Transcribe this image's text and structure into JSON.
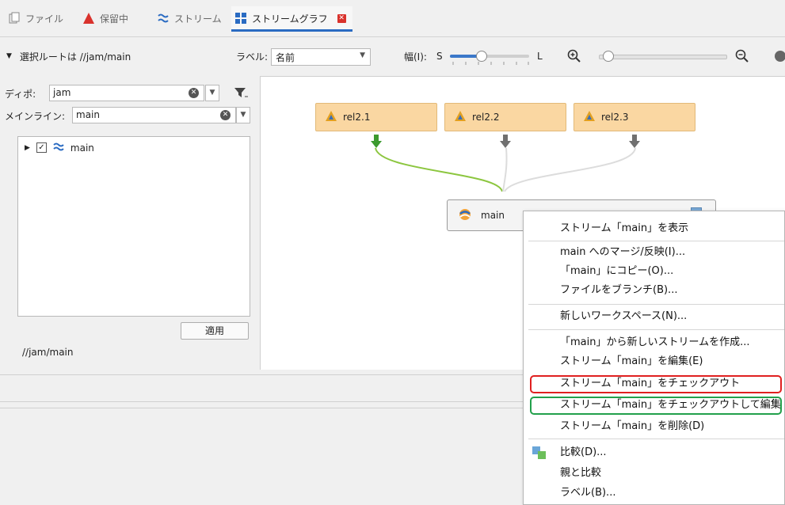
{
  "tabs": [
    {
      "label": "ファイル",
      "icon": "file-icon"
    },
    {
      "label": "保留中",
      "icon": "pending-triangle-icon"
    },
    {
      "label": "ストリーム",
      "icon": "stream-icon"
    },
    {
      "label": "ストリームグラフ",
      "icon": "stream-graph-icon",
      "close": "✕"
    }
  ],
  "toolbar": {
    "root_text": "選択ルートは //jam/main",
    "label_caption": "ラベル:",
    "label_value": "名前",
    "width_caption": "幅(I):",
    "width_small": "S",
    "width_large": "L",
    "width_level": 0.4,
    "zoom_level": 0.03
  },
  "left": {
    "depot_label": "ディポ:",
    "depot_value": "jam",
    "mainline_label": "メインライン:",
    "mainline_value": "main",
    "tree_item": "main",
    "apply_label": "適用",
    "status_path": "//jam/main"
  },
  "graph": {
    "nodes": [
      "rel2.1",
      "rel2.2",
      "rel2.3"
    ],
    "main_node": "main"
  },
  "menu": {
    "items": [
      "ストリーム「main」を表示",
      "main へのマージ/反映(I)...",
      "「main」にコピー(O)...",
      "ファイルをブランチ(B)...",
      "新しいワークスペース(N)...",
      "「main」から新しいストリームを作成...",
      "ストリーム「main」を編集(E)",
      "ストリーム「main」をチェックアウト",
      "ストリーム「main」をチェックアウトして編集",
      "ストリーム「main」を削除(D)",
      "比較(D)...",
      "親と比較",
      "ラベル(B)..."
    ]
  },
  "colors": {
    "accent": "#2a6bc2",
    "release_node": "#fad7a2",
    "highlight_red": "#e02020",
    "highlight_green": "#22a04b",
    "edge_green": "#8cc63f"
  }
}
